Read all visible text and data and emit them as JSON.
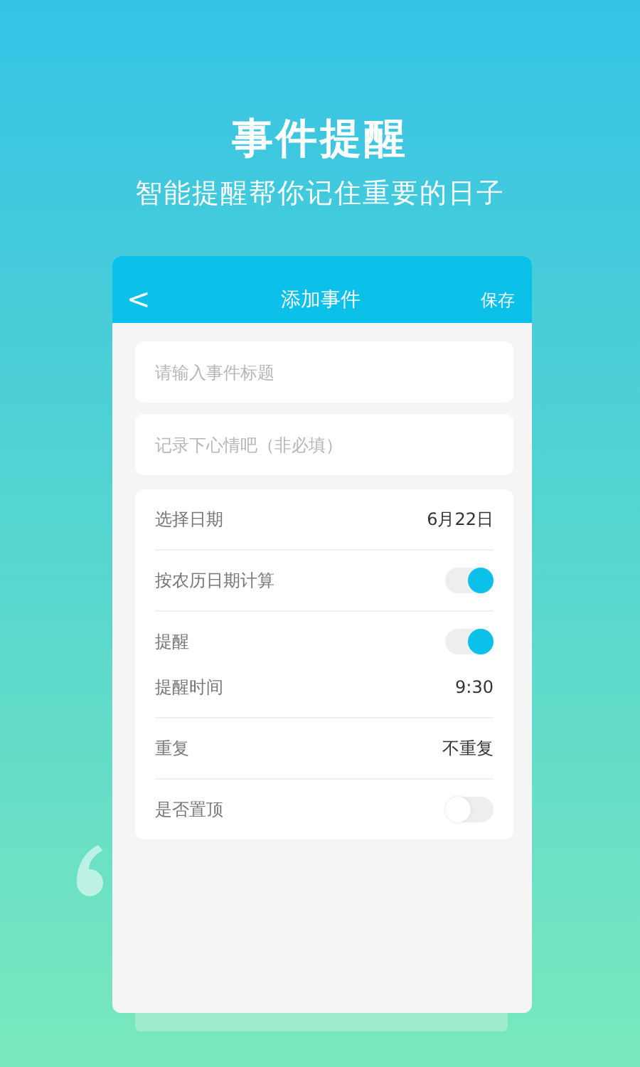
{
  "headline": "事件提醒",
  "subheadline": "智能提醒帮你记住重要的日子",
  "app_bar": {
    "back": "<",
    "title": "添加事件",
    "action": "保存"
  },
  "fields": [
    {
      "placeholder": "请输入事件标题"
    },
    {
      "placeholder": "记录下心情吧（非必填）"
    }
  ],
  "settings": [
    [
      {
        "kind": "value",
        "label": "选择日期",
        "value": "6月22日"
      }
    ],
    [
      {
        "kind": "toggle",
        "label": "按农历日期计算",
        "on": true
      }
    ],
    [
      {
        "kind": "toggle",
        "label": "提醒",
        "on": true
      },
      {
        "kind": "value",
        "label": "提醒时间",
        "value": "9:30"
      }
    ],
    [
      {
        "kind": "value",
        "label": "重复",
        "value": "不重复"
      }
    ],
    [
      {
        "kind": "toggle",
        "label": "是否置顶",
        "on": false
      }
    ]
  ]
}
